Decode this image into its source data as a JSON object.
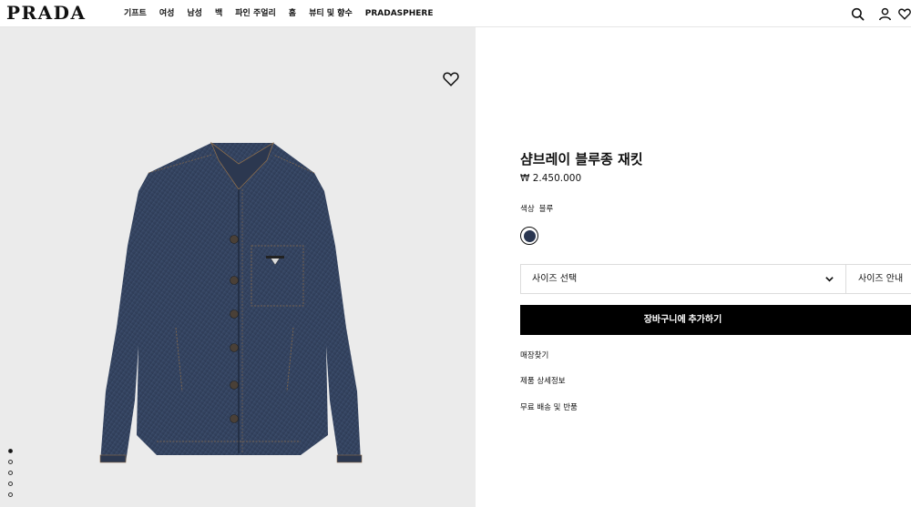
{
  "header": {
    "logo": "PRADA",
    "nav": [
      "기프트",
      "여성",
      "남성",
      "백",
      "파인 주얼리",
      "홈",
      "뷰티 및 향수",
      "PRADASPHERE"
    ]
  },
  "gallery": {
    "current_image": 1,
    "image_count": 5
  },
  "product": {
    "title": "샴브레이 블루종 재킷",
    "price": "₩ 2.450.000",
    "color_label": "색상",
    "color_value": "블루",
    "swatch_color": "#2a3650",
    "size_select": "사이즈 선택",
    "size_guide": "사이즈 안내",
    "add_to_cart": "장바구니에 추가하기",
    "links": [
      "매장찾기",
      "제품 상세정보",
      "무료 배송 및 반품"
    ]
  }
}
